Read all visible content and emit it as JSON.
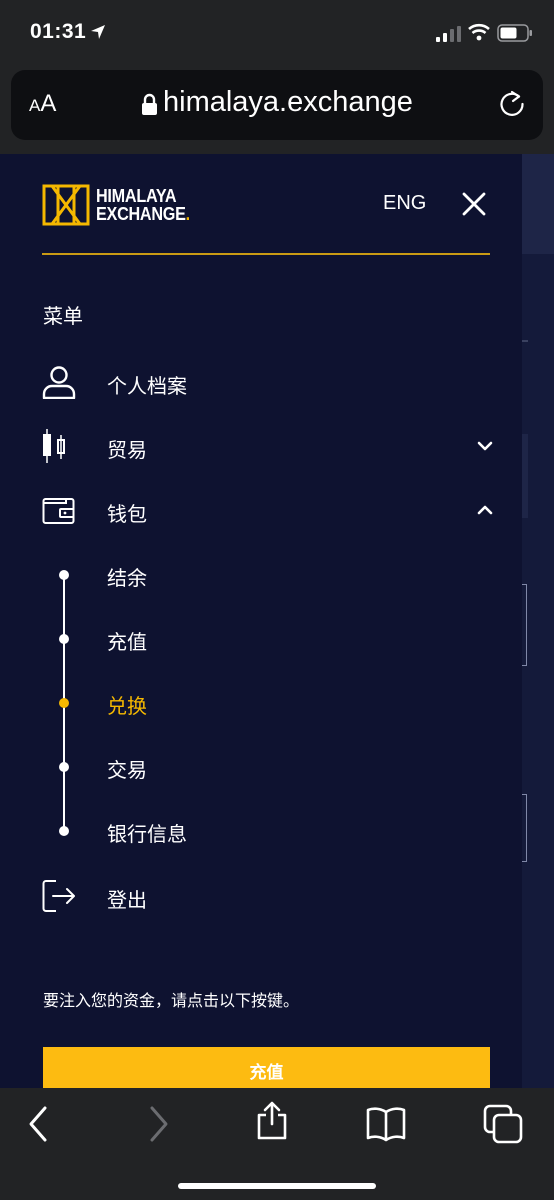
{
  "status_bar": {
    "time": "01:31"
  },
  "browser": {
    "aa_small": "A",
    "aa_large": "A",
    "url": "himalaya.exchange"
  },
  "drawer": {
    "brand_line1": "HIMALAYA",
    "brand_line2": "EXCHANGE",
    "brand_dot": ".",
    "language": "ENG",
    "menu_heading": "菜单",
    "items": [
      {
        "label": "个人档案",
        "icon": "user-icon"
      },
      {
        "label": "贸易",
        "icon": "candlestick-icon",
        "chevron": "down"
      },
      {
        "label": "钱包",
        "icon": "wallet-icon",
        "chevron": "up"
      }
    ],
    "wallet_subitems": [
      {
        "label": "结余",
        "active": false
      },
      {
        "label": "充值",
        "active": false
      },
      {
        "label": "兑换",
        "active": true
      },
      {
        "label": "交易",
        "active": false
      },
      {
        "label": "银行信息",
        "active": false
      }
    ],
    "logout_label": "登出",
    "deposit_note": "要注入您的资金，请点击以下按键。",
    "deposit_button": "充值"
  },
  "colors": {
    "background": "#0e1230",
    "accent": "#f5b800",
    "button": "#fdbb11"
  }
}
